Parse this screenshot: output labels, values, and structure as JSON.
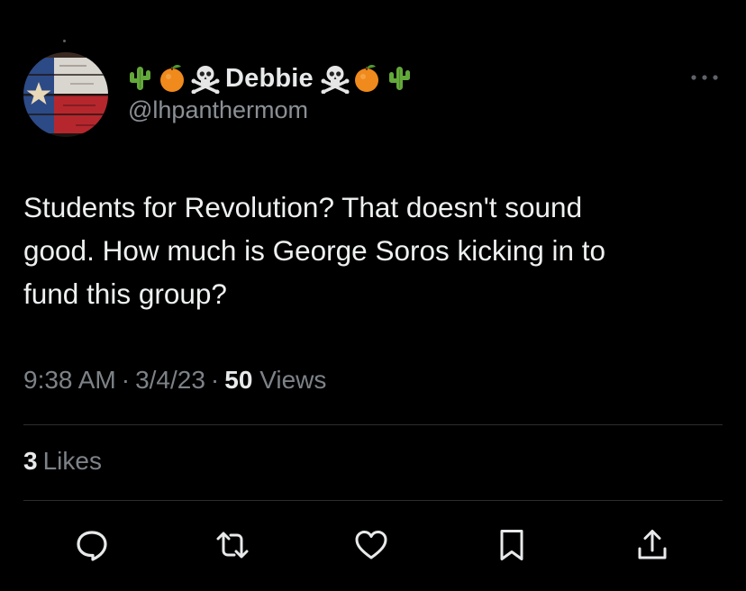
{
  "tweet": {
    "author": {
      "display_name": "Debbie",
      "handle": "@lhpanthermom",
      "name_emojis_before": [
        "cactus",
        "orange",
        "skull-and-crossbones"
      ],
      "name_emojis_after": [
        "skull-and-crossbones",
        "orange",
        "cactus"
      ],
      "avatar": "texas-flag"
    },
    "text_lines": [
      "Students for Revolution? That doesn't sound",
      "good. How much is George Soros kicking in to",
      "fund this group?"
    ],
    "time": "9:38 AM",
    "date": "3/4/23",
    "separator": "·",
    "views_count": "50",
    "views_label": "Views",
    "likes_count": "3",
    "likes_label": "Likes"
  },
  "actions": [
    "reply-icon",
    "retweet-icon",
    "like-icon",
    "bookmark-icon",
    "share-icon"
  ],
  "colors": {
    "background": "#000000",
    "primary_text": "#e7e9ea",
    "secondary_text": "#7d8288",
    "divider": "#2a2d30"
  }
}
